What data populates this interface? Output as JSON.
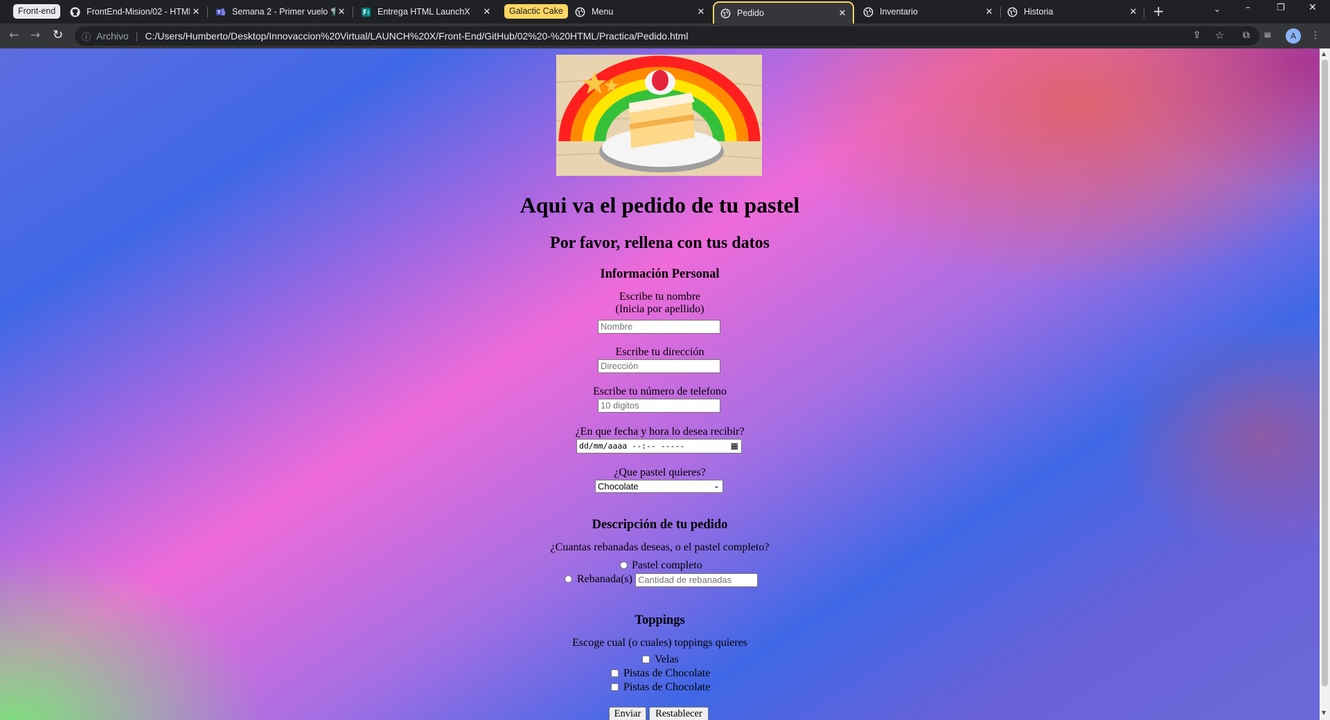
{
  "tab_groups": [
    {
      "label": "Front-end"
    },
    {
      "label": "Galactic Cake"
    }
  ],
  "tabs": [
    {
      "label": "FrontEnd-Mision/02 - HTML",
      "icon": "github-icon"
    },
    {
      "label": "Semana 2 - Primer vuelo 🛸",
      "icon": "teams-icon"
    },
    {
      "label": "Entrega HTML LaunchX",
      "icon": "forms-icon"
    },
    {
      "label": "Menu",
      "icon": "globe-icon"
    },
    {
      "label": "Pedido",
      "icon": "globe-icon",
      "active": true
    },
    {
      "label": "Inventario",
      "icon": "globe-icon"
    },
    {
      "label": "Historia",
      "icon": "globe-icon"
    }
  ],
  "toolbar": {
    "scheme_label": "Archivo",
    "url": "C:/Users/Humberto/Desktop/Innovaccion%20Virtual/LAUNCH%20X/Front-End/GitHub/02%20-%20HTML/Practica/Pedido.html",
    "profile_initial": "A"
  },
  "page": {
    "title": "Aqui va el pedido de tu pastel",
    "subtitle": "Por favor, rellena con tus datos",
    "personal": {
      "heading": "Información Personal",
      "name_label_1": "Escribe tu nombre",
      "name_label_2": "(Inicia por apellido)",
      "name_placeholder": "Nombre",
      "address_label": "Escribe tu dirección",
      "address_placeholder": "Dirección",
      "phone_label": "Escribe tu número de telefono",
      "phone_placeholder": "10 digitos",
      "datetime_label": "¿En que fecha y hora lo desea recibir?",
      "datetime_value": "dd/mm/aaaa --:-- -----",
      "cake_label": "¿Que pastel quieres?",
      "cake_selected": "Chocolate"
    },
    "order": {
      "heading": "Descripción de tu pedido",
      "question": "¿Cuantas rebanadas deseas, o el pastel completo?",
      "option_whole": "Pastel completo",
      "option_slices": "Rebanada(s)",
      "slices_placeholder": "Cantidad de rebanadas"
    },
    "toppings": {
      "heading": "Toppings",
      "question": "Escoge cual (o cuales) toppings quieres",
      "options": [
        "Velas",
        "Pistas de Chocolate",
        "Pistas de Chocolate"
      ]
    },
    "buttons": {
      "submit": "Enviar",
      "reset": "Restablecer"
    }
  },
  "colors": {
    "tab_group_frontend": "#e8eaed",
    "tab_group_galactic": "#fdd663",
    "browser_dark": "#202124",
    "browser_toolbar": "#35363a"
  }
}
